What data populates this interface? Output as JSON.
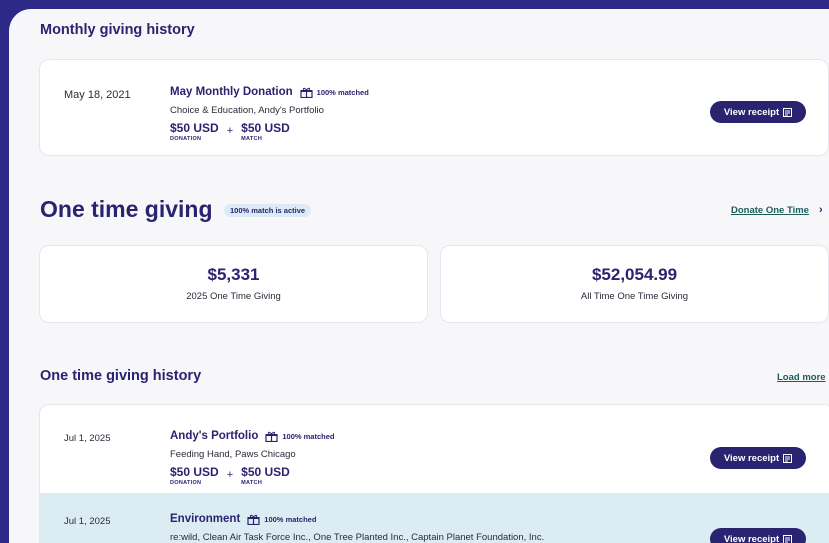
{
  "monthly": {
    "title": "Monthly giving history",
    "donation": {
      "date": "May 18, 2021",
      "title": "May Monthly Donation",
      "matched": "100% matched",
      "orgs": "Choice & Education, Andy's Portfolio",
      "donation_amount": "$50 USD",
      "donation_caption": "DONATION",
      "plus": "+",
      "match_amount": "$50 USD",
      "match_caption": "MATCH",
      "receipt": "View receipt"
    }
  },
  "one_time": {
    "title": "One time giving",
    "badge": "100% match is active",
    "donate_link": "Donate One Time",
    "donate_chevron": "›",
    "stats": [
      {
        "value": "$5,331",
        "label": "2025 One Time Giving"
      },
      {
        "value": "$52,054.99",
        "label": "All Time One Time Giving"
      }
    ]
  },
  "history": {
    "title": "One time giving history",
    "load_more": "Load more",
    "items": [
      {
        "date": "Jul 1, 2025",
        "title": "Andy's Portfolio",
        "matched": "100% matched",
        "orgs": "Feeding Hand, Paws Chicago",
        "donation_amount": "$50 USD",
        "donation_caption": "DONATION",
        "plus": "+",
        "match_amount": "$50 USD",
        "match_caption": "MATCH",
        "receipt": "View receipt"
      },
      {
        "date": "Jul 1, 2025",
        "title": "Environment",
        "matched": "100% matched",
        "orgs": "re:wild, Clean Air Task Force Inc., One Tree Planted Inc., Captain Planet Foundation, Inc.",
        "receipt": "View receipt"
      }
    ]
  },
  "icons": {
    "gift": "gift-icon",
    "receipt": "receipt-doc-icon",
    "chevron": "chevron-right-icon"
  },
  "colors": {
    "frame": "#2c2a86",
    "navy": "#2a2370",
    "link": "#1b5e5b",
    "badge_bg": "#dcebf5",
    "highlight_row": "#dbecf3"
  }
}
